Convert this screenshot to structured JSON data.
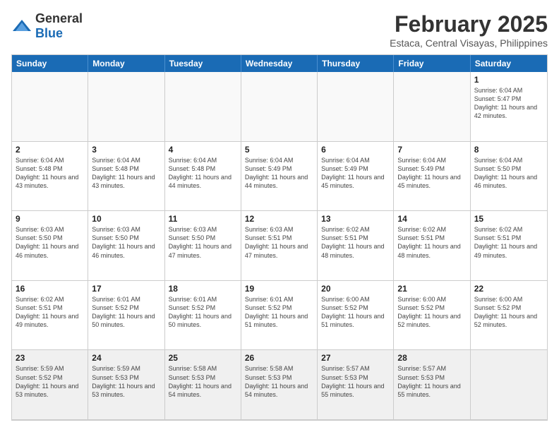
{
  "header": {
    "logo": {
      "general": "General",
      "blue": "Blue"
    },
    "month": "February 2025",
    "location": "Estaca, Central Visayas, Philippines"
  },
  "dayNames": [
    "Sunday",
    "Monday",
    "Tuesday",
    "Wednesday",
    "Thursday",
    "Friday",
    "Saturday"
  ],
  "weeks": [
    [
      {
        "day": "",
        "empty": true
      },
      {
        "day": "",
        "empty": true
      },
      {
        "day": "",
        "empty": true
      },
      {
        "day": "",
        "empty": true
      },
      {
        "day": "",
        "empty": true
      },
      {
        "day": "",
        "empty": true
      },
      {
        "day": "1",
        "sunrise": "6:04 AM",
        "sunset": "5:47 PM",
        "daylight": "11 hours and 42 minutes."
      }
    ],
    [
      {
        "day": "2",
        "sunrise": "6:04 AM",
        "sunset": "5:48 PM",
        "daylight": "11 hours and 43 minutes."
      },
      {
        "day": "3",
        "sunrise": "6:04 AM",
        "sunset": "5:48 PM",
        "daylight": "11 hours and 43 minutes."
      },
      {
        "day": "4",
        "sunrise": "6:04 AM",
        "sunset": "5:48 PM",
        "daylight": "11 hours and 44 minutes."
      },
      {
        "day": "5",
        "sunrise": "6:04 AM",
        "sunset": "5:49 PM",
        "daylight": "11 hours and 44 minutes."
      },
      {
        "day": "6",
        "sunrise": "6:04 AM",
        "sunset": "5:49 PM",
        "daylight": "11 hours and 45 minutes."
      },
      {
        "day": "7",
        "sunrise": "6:04 AM",
        "sunset": "5:49 PM",
        "daylight": "11 hours and 45 minutes."
      },
      {
        "day": "8",
        "sunrise": "6:04 AM",
        "sunset": "5:50 PM",
        "daylight": "11 hours and 46 minutes."
      }
    ],
    [
      {
        "day": "9",
        "sunrise": "6:03 AM",
        "sunset": "5:50 PM",
        "daylight": "11 hours and 46 minutes."
      },
      {
        "day": "10",
        "sunrise": "6:03 AM",
        "sunset": "5:50 PM",
        "daylight": "11 hours and 46 minutes."
      },
      {
        "day": "11",
        "sunrise": "6:03 AM",
        "sunset": "5:50 PM",
        "daylight": "11 hours and 47 minutes."
      },
      {
        "day": "12",
        "sunrise": "6:03 AM",
        "sunset": "5:51 PM",
        "daylight": "11 hours and 47 minutes."
      },
      {
        "day": "13",
        "sunrise": "6:02 AM",
        "sunset": "5:51 PM",
        "daylight": "11 hours and 48 minutes."
      },
      {
        "day": "14",
        "sunrise": "6:02 AM",
        "sunset": "5:51 PM",
        "daylight": "11 hours and 48 minutes."
      },
      {
        "day": "15",
        "sunrise": "6:02 AM",
        "sunset": "5:51 PM",
        "daylight": "11 hours and 49 minutes."
      }
    ],
    [
      {
        "day": "16",
        "sunrise": "6:02 AM",
        "sunset": "5:51 PM",
        "daylight": "11 hours and 49 minutes."
      },
      {
        "day": "17",
        "sunrise": "6:01 AM",
        "sunset": "5:52 PM",
        "daylight": "11 hours and 50 minutes."
      },
      {
        "day": "18",
        "sunrise": "6:01 AM",
        "sunset": "5:52 PM",
        "daylight": "11 hours and 50 minutes."
      },
      {
        "day": "19",
        "sunrise": "6:01 AM",
        "sunset": "5:52 PM",
        "daylight": "11 hours and 51 minutes."
      },
      {
        "day": "20",
        "sunrise": "6:00 AM",
        "sunset": "5:52 PM",
        "daylight": "11 hours and 51 minutes."
      },
      {
        "day": "21",
        "sunrise": "6:00 AM",
        "sunset": "5:52 PM",
        "daylight": "11 hours and 52 minutes."
      },
      {
        "day": "22",
        "sunrise": "6:00 AM",
        "sunset": "5:52 PM",
        "daylight": "11 hours and 52 minutes."
      }
    ],
    [
      {
        "day": "23",
        "sunrise": "5:59 AM",
        "sunset": "5:52 PM",
        "daylight": "11 hours and 53 minutes."
      },
      {
        "day": "24",
        "sunrise": "5:59 AM",
        "sunset": "5:53 PM",
        "daylight": "11 hours and 53 minutes."
      },
      {
        "day": "25",
        "sunrise": "5:58 AM",
        "sunset": "5:53 PM",
        "daylight": "11 hours and 54 minutes."
      },
      {
        "day": "26",
        "sunrise": "5:58 AM",
        "sunset": "5:53 PM",
        "daylight": "11 hours and 54 minutes."
      },
      {
        "day": "27",
        "sunrise": "5:57 AM",
        "sunset": "5:53 PM",
        "daylight": "11 hours and 55 minutes."
      },
      {
        "day": "28",
        "sunrise": "5:57 AM",
        "sunset": "5:53 PM",
        "daylight": "11 hours and 55 minutes."
      },
      {
        "day": "",
        "empty": true
      }
    ]
  ]
}
